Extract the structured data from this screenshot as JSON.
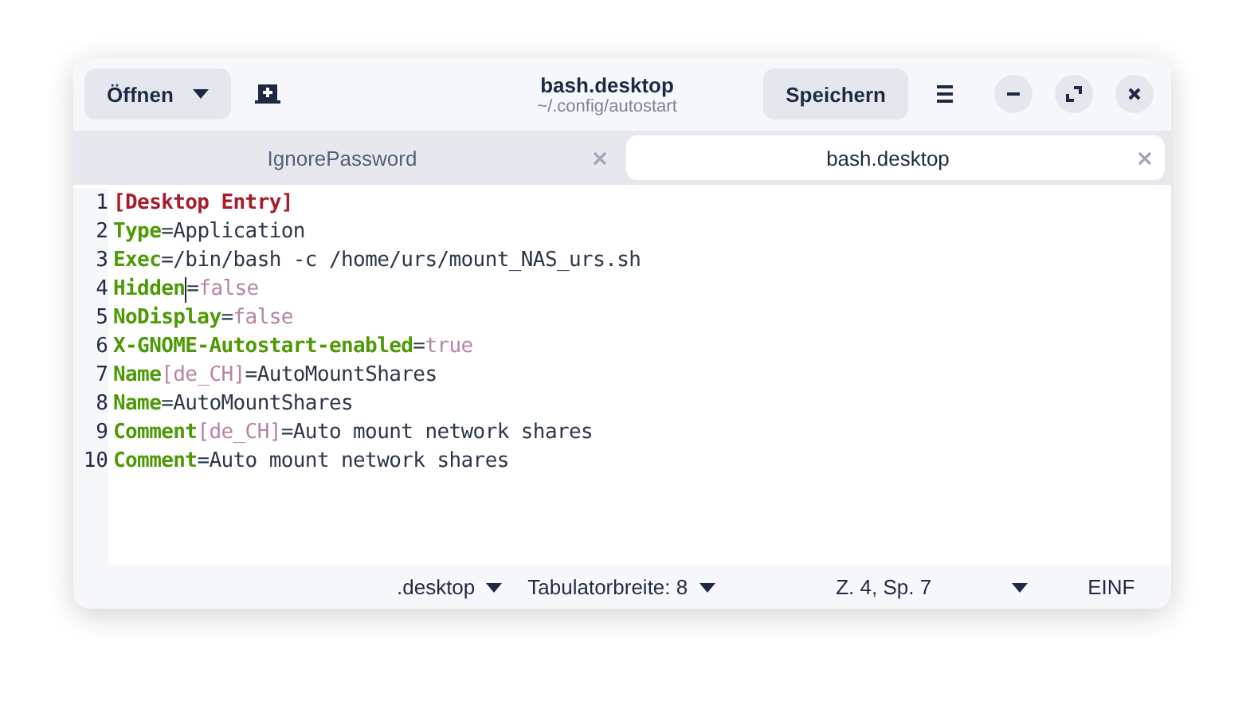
{
  "header": {
    "open_button": "Öffnen",
    "title": "bash.desktop",
    "subtitle": "~/.config/autostart",
    "save_button": "Speichern"
  },
  "tabs": [
    {
      "label": "IgnorePassword",
      "selected": false
    },
    {
      "label": "bash.desktop",
      "selected": true
    }
  ],
  "editor": {
    "lines": [
      {
        "number": "1",
        "segments": [
          {
            "kind": "section",
            "text": "[Desktop Entry]"
          }
        ]
      },
      {
        "number": "2",
        "segments": [
          {
            "kind": "key",
            "text": "Type"
          },
          {
            "kind": "plain",
            "text": "=Application"
          }
        ]
      },
      {
        "number": "3",
        "segments": [
          {
            "kind": "key",
            "text": "Exec"
          },
          {
            "kind": "plain",
            "text": "=/bin/bash -c /home/urs/mount_NAS_urs.sh"
          }
        ]
      },
      {
        "number": "4",
        "segments": [
          {
            "kind": "key",
            "text": "Hidden"
          },
          {
            "kind": "cursor"
          },
          {
            "kind": "plain",
            "text": "="
          },
          {
            "kind": "literal",
            "text": "false"
          }
        ]
      },
      {
        "number": "5",
        "segments": [
          {
            "kind": "key",
            "text": "NoDisplay"
          },
          {
            "kind": "plain",
            "text": "="
          },
          {
            "kind": "literal",
            "text": "false"
          }
        ]
      },
      {
        "number": "6",
        "segments": [
          {
            "kind": "key",
            "text": "X-GNOME-Autostart-enabled"
          },
          {
            "kind": "plain",
            "text": "="
          },
          {
            "kind": "literal",
            "text": "true"
          }
        ]
      },
      {
        "number": "7",
        "segments": [
          {
            "kind": "key",
            "text": "Name"
          },
          {
            "kind": "literal",
            "text": "[de_CH]"
          },
          {
            "kind": "plain",
            "text": "=AutoMountShares"
          }
        ]
      },
      {
        "number": "8",
        "segments": [
          {
            "kind": "key",
            "text": "Name"
          },
          {
            "kind": "plain",
            "text": "=AutoMountShares"
          }
        ]
      },
      {
        "number": "9",
        "segments": [
          {
            "kind": "key",
            "text": "Comment"
          },
          {
            "kind": "literal",
            "text": "[de_CH]"
          },
          {
            "kind": "plain",
            "text": "=Auto mount network shares"
          }
        ]
      },
      {
        "number": "10",
        "segments": [
          {
            "kind": "key",
            "text": "Comment"
          },
          {
            "kind": "plain",
            "text": "=Auto mount network shares"
          }
        ]
      }
    ]
  },
  "status_bar": {
    "language": ".desktop",
    "tab_width": "Tabulatorbreite: 8",
    "position": "Z. 4, Sp. 7",
    "mode": "EINF"
  }
}
